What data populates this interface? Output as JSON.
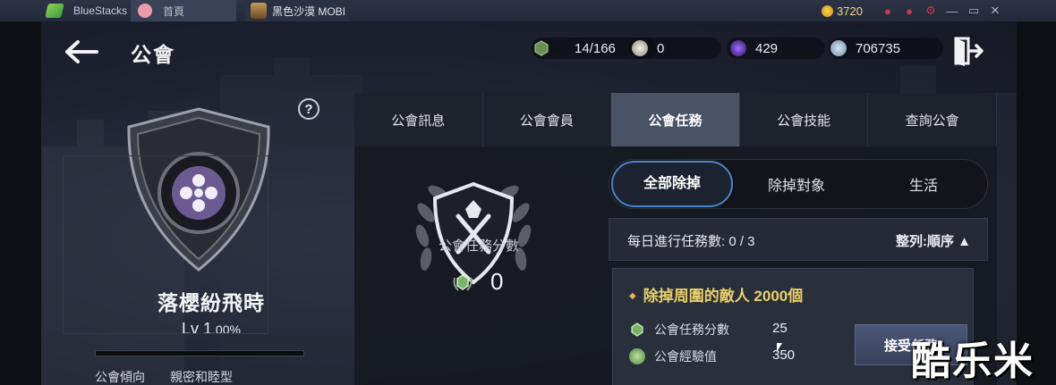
{
  "titlebar": {
    "brand": "BlueStacks",
    "tab_home": "首頁",
    "tab_game": "黑色沙漠 MOBI",
    "coins": "3720"
  },
  "header": {
    "title": "公會",
    "resources": [
      {
        "name": "guild-mission-points",
        "value": "14/166"
      },
      {
        "name": "pearl",
        "value": "0"
      },
      {
        "name": "dark-orb",
        "value": "429"
      },
      {
        "name": "silver",
        "value": "706735"
      }
    ]
  },
  "guild": {
    "name": "落櫻紛飛時",
    "level": "Lv 1",
    "level_pct": ".00%",
    "exp_fraction": 0,
    "tendency_label": "公會傾向",
    "tendency_value": "親密和睦型"
  },
  "tabs": [
    "公會訊息",
    "公會會員",
    "公會任務",
    "公會技能",
    "查詢公會"
  ],
  "active_tab": 2,
  "mission_score": {
    "label": "公會任務分數",
    "value": "0"
  },
  "subtabs": [
    "全部除掉",
    "除掉對象",
    "生活"
  ],
  "daily": {
    "text": "每日進行任務數: 0 / 3",
    "sort": "整列:順序 ▲"
  },
  "mission": {
    "title": "除掉周圍的敵人 2000個",
    "rows": [
      {
        "label": "公會任務分數",
        "value": "25"
      },
      {
        "label": "公會經驗值",
        "value": "350"
      }
    ],
    "accept_label": "接受任務"
  },
  "watermark": "酷乐米",
  "colors": {
    "accent": "#4a82c8",
    "mission_title": "#e8cf6a",
    "active_tab": "#4a5266"
  }
}
